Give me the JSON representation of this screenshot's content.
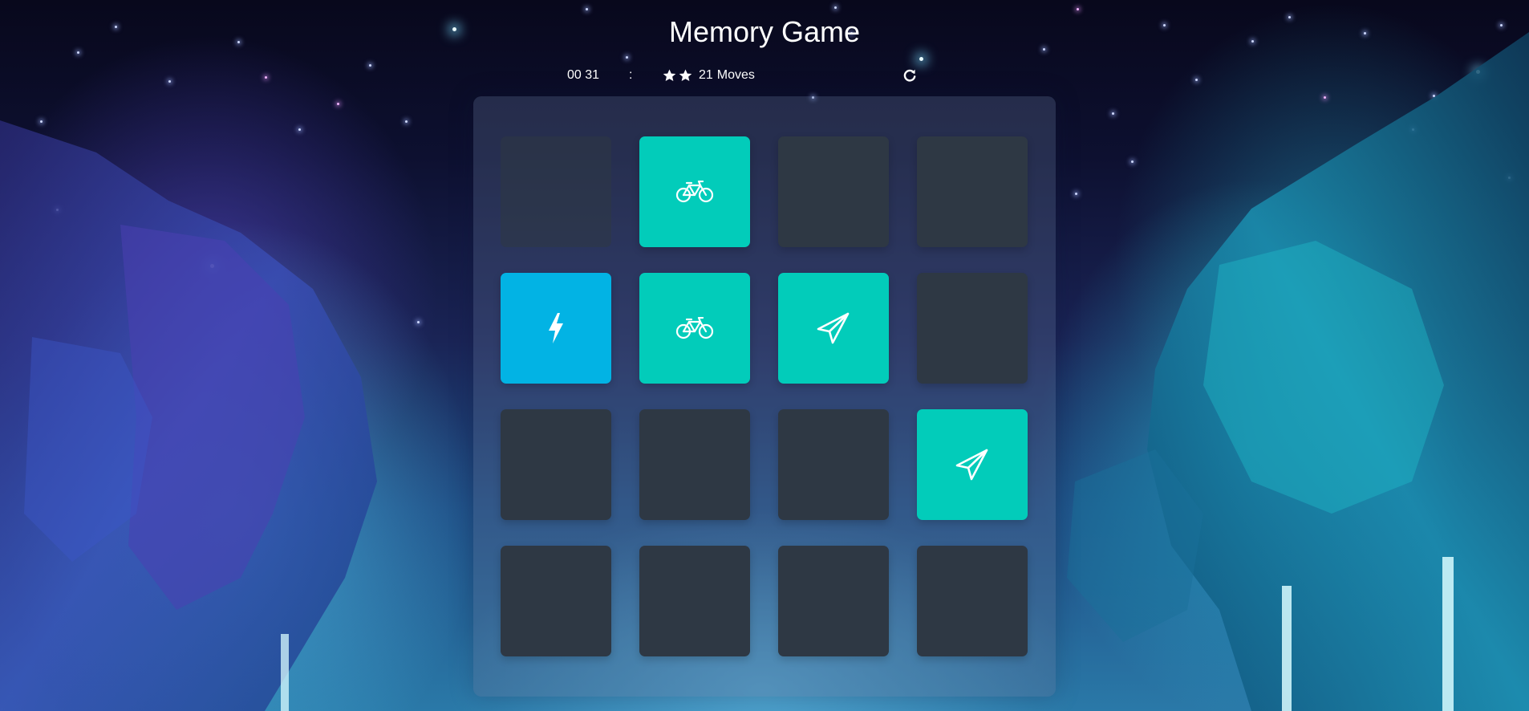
{
  "title": "Memory Game",
  "score_panel": {
    "timer": "00 31",
    "separator": ":",
    "stars_count": 2,
    "moves_count": "21",
    "moves_label": "Moves",
    "restart_icon": "restart-icon"
  },
  "deck": {
    "rows": 4,
    "columns": 4,
    "cards": [
      {
        "state": "closed",
        "icon": ""
      },
      {
        "state": "match",
        "icon": "bicycle-icon"
      },
      {
        "state": "closed",
        "icon": ""
      },
      {
        "state": "closed",
        "icon": ""
      },
      {
        "state": "open",
        "icon": "bolt-icon"
      },
      {
        "state": "match",
        "icon": "bicycle-icon"
      },
      {
        "state": "match",
        "icon": "paper-plane-icon"
      },
      {
        "state": "closed",
        "icon": ""
      },
      {
        "state": "closed",
        "icon": ""
      },
      {
        "state": "closed",
        "icon": ""
      },
      {
        "state": "closed",
        "icon": ""
      },
      {
        "state": "match",
        "icon": "paper-plane-icon"
      },
      {
        "state": "closed",
        "icon": ""
      },
      {
        "state": "closed",
        "icon": ""
      },
      {
        "state": "closed",
        "icon": ""
      },
      {
        "state": "closed",
        "icon": ""
      }
    ]
  },
  "colors": {
    "card_closed": "#2e3844",
    "card_match": "#02ccba",
    "card_open": "#02b3e4",
    "text": "#ffffff"
  }
}
